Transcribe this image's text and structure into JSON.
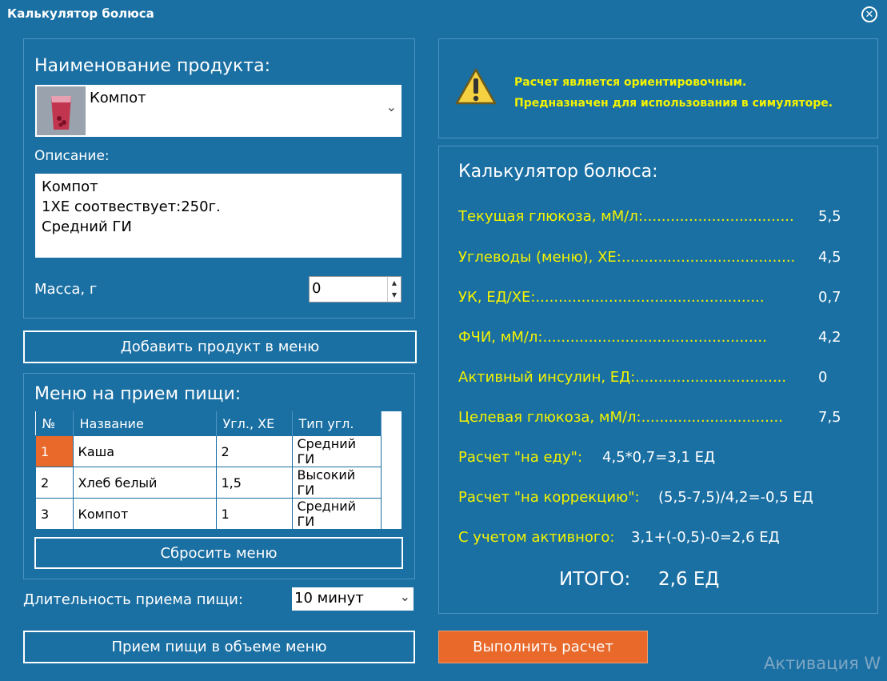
{
  "window": {
    "title": "Калькулятор болюса"
  },
  "product": {
    "label": "Наименование продукта:",
    "selected": "Компот",
    "description_label": "Описание:",
    "description_lines": [
      "Компот",
      "1ХЕ соотвествует:250г.",
      "Средний ГИ"
    ],
    "mass_label": "Масса, г",
    "mass_value": "0"
  },
  "buttons": {
    "add_to_menu": "Добавить продукт в меню",
    "reset_menu": "Сбросить меню",
    "eat_menu": "Прием пищи в объеме меню",
    "calculate": "Выполнить расчет"
  },
  "menu": {
    "label": "Меню на прием пищи:",
    "columns": [
      "№",
      "Название",
      "Угл., ХЕ",
      "Тип угл."
    ],
    "rows": [
      [
        "1",
        "Каша",
        "2",
        "Средний ГИ"
      ],
      [
        "2",
        "Хлеб белый",
        "1,5",
        "Высокий ГИ"
      ],
      [
        "3",
        "Компот",
        "1",
        "Средний ГИ"
      ]
    ]
  },
  "duration": {
    "label": "Длительность приема пищи:",
    "value": "10 минут"
  },
  "warning": {
    "line1": "Расчет является ориентировочным.",
    "line2": "Предназначен для использования в симуляторе."
  },
  "calc": {
    "title": "Калькулятор болюса:",
    "rows": [
      {
        "label": "Текущая глюкоза, мМ/л:.................................",
        "value": "5,5"
      },
      {
        "label": "Углеводы (меню), ХЕ:......................................",
        "value": "4,5"
      },
      {
        "label": "УК, ЕД/ХЕ:..................................................",
        "value": "0,7"
      },
      {
        "label": "ФЧИ, мМ/л:.................................................",
        "value": "4,2"
      },
      {
        "label": "Активный инсулин, ЕД:.................................",
        "value": "0"
      },
      {
        "label": "Целевая глюкоза, мМ/л:...............................",
        "value": "7,5"
      }
    ],
    "food_label": "Расчет \"на еду\":",
    "food_value": "4,5*0,7=3,1 ЕД",
    "correction_label": "Расчет \"на коррекцию\":",
    "correction_value": "(5,5-7,5)/4,2=-0,5 ЕД",
    "active_label": "С учетом активного:",
    "active_value": "3,1+(-0,5)-0=2,6 ЕД",
    "total_label": "ИТОГО:",
    "total_value": "2,6 ЕД"
  },
  "watermark": "Активация W",
  "colors": {
    "background": "#1a6fa3",
    "accent": "#e8692a",
    "highlight": "#f3f300"
  }
}
